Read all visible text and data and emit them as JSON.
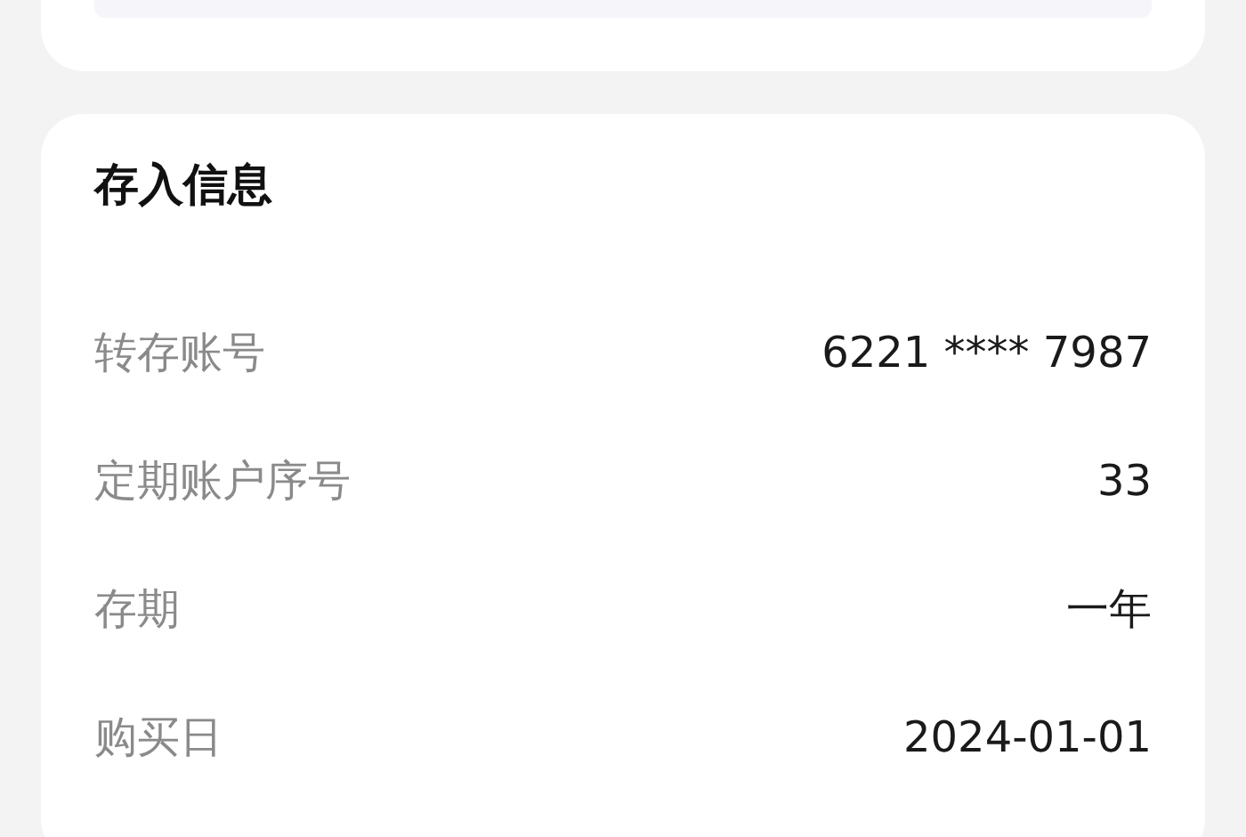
{
  "section": {
    "title": "存入信息",
    "rows": [
      {
        "label": "转存账号",
        "value": "6221 **** 7987"
      },
      {
        "label": "定期账户序号",
        "value": "33"
      },
      {
        "label": "存期",
        "value": "一年"
      },
      {
        "label": "购买日",
        "value": "2024-01-01"
      }
    ]
  }
}
